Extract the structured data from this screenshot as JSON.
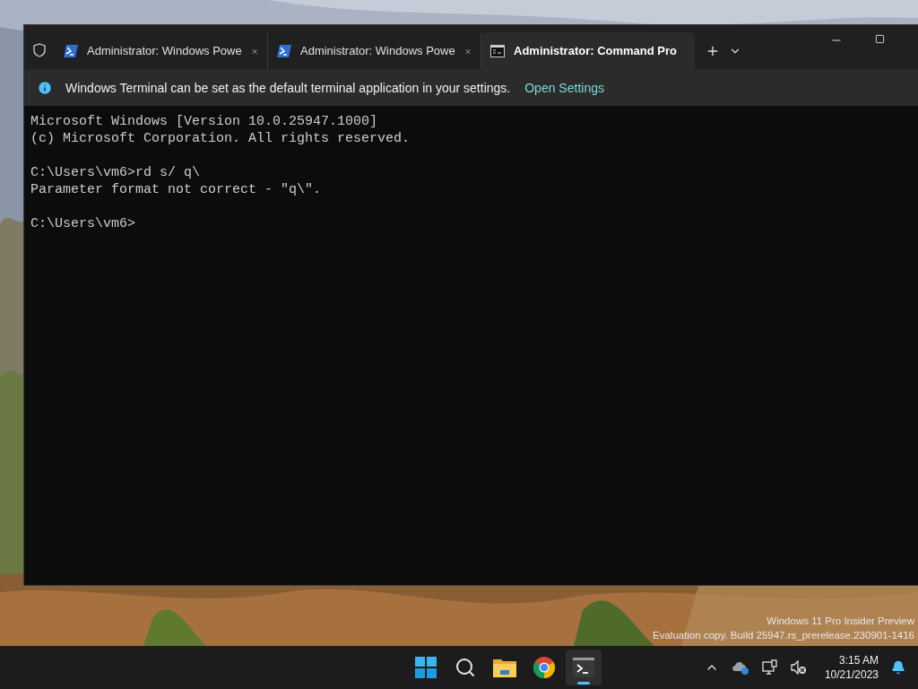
{
  "tabs": [
    {
      "title": "Administrator: Windows Powe",
      "kind": "powershell",
      "selected": false
    },
    {
      "title": "Administrator: Windows Powe",
      "kind": "powershell",
      "selected": false
    },
    {
      "title": "Administrator: Command Pro",
      "kind": "cmd",
      "selected": true
    }
  ],
  "infobar": {
    "message": "Windows Terminal can be set as the default terminal application in your settings.",
    "link": "Open Settings"
  },
  "terminal": {
    "blocks": [
      [
        "Microsoft Windows [Version 10.0.25947.1000]",
        "(c) Microsoft Corporation. All rights reserved."
      ],
      [
        "C:\\Users\\vm6>rd s/ q\\",
        "Parameter format not correct - \"q\\\"."
      ],
      [
        "C:\\Users\\vm6>"
      ]
    ]
  },
  "watermark": [
    "Windows 11 Pro Insider Preview",
    "Evaluation copy. Build 25947.rs_prerelease.230901-1416"
  ],
  "taskbar": {
    "apps": [
      {
        "kind": "start",
        "selected": false
      },
      {
        "kind": "search",
        "selected": false
      },
      {
        "kind": "files",
        "selected": false
      },
      {
        "kind": "browser",
        "selected": false
      },
      {
        "kind": "terminal",
        "selected": true
      }
    ],
    "clock": {
      "time": "3:15 AM",
      "date": "10/21/2023"
    }
  }
}
